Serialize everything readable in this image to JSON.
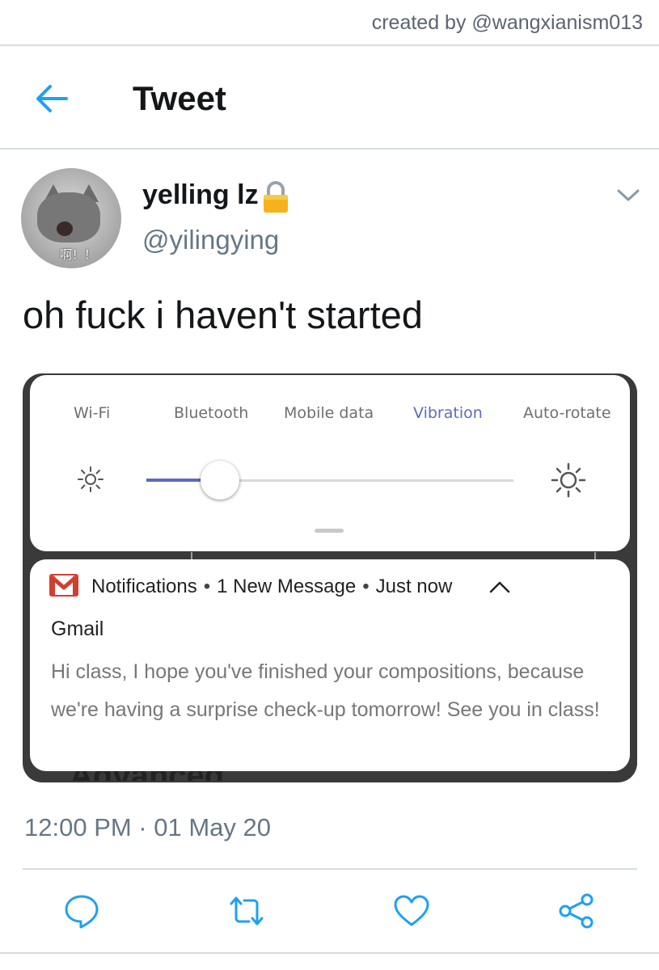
{
  "credit": "created by @wangxianism013",
  "header": {
    "title": "Tweet",
    "back_icon": "arrow-left-icon"
  },
  "tweet": {
    "display_name": "yelling lz",
    "handle": "@yilingying",
    "avatar_caption": "啊！！",
    "text": "oh fuck i haven't started",
    "timestamp": "12:00 PM · 01 May 20",
    "lock_icon": "lock-icon",
    "accent": "#1da1f2"
  },
  "screenshot": {
    "quick_settings": {
      "tiles": [
        {
          "label": "Wi-Fi",
          "active": false
        },
        {
          "label": "Bluetooth",
          "active": false
        },
        {
          "label": "Mobile data",
          "active": false
        },
        {
          "label": "Vibration",
          "active": true
        },
        {
          "label": "Auto-rotate",
          "active": false
        }
      ],
      "brightness_fraction": 0.2,
      "active_color": "#5c6bc0"
    },
    "notification": {
      "app": "Notifications",
      "summary": "1 New Message",
      "time": "Just now",
      "title": "Gmail",
      "body": "Hi class, I hope you've finished your compositions, because we're having a surprise check-up tomorrow! See you in class!"
    },
    "behind_text": "Advanced"
  },
  "actions": [
    "reply-icon",
    "retweet-icon",
    "like-icon",
    "share-icon"
  ]
}
